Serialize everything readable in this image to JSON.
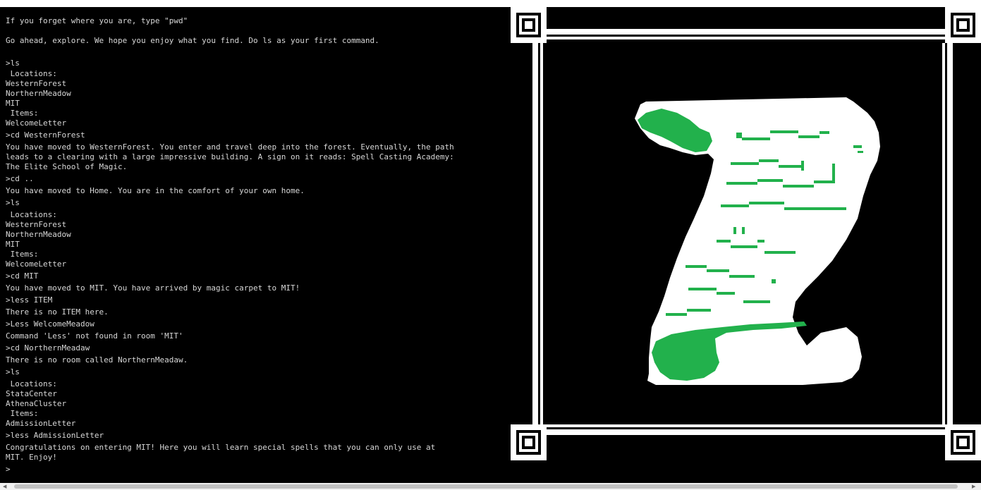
{
  "terminal": {
    "lines": [
      "If you forget where you are, type \"pwd\"",
      "Go ahead, explore. We hope you enjoy what you find. Do ls as your first command.",
      ">ls",
      " Locations:",
      "WesternForest",
      "NorthernMeadow",
      "MIT",
      " Items:",
      "WelcomeLetter",
      ">cd WesternForest",
      "You have moved to WesternForest. You enter and travel deep into the forest. Eventually, the path",
      "leads to a clearing with a large impressive building. A sign on it reads: Spell Casting Academy:",
      "The Elite School of Magic.",
      ">cd ..",
      "You have moved to Home. You are in the comfort of your own home.",
      ">ls",
      " Locations:",
      "WesternForest",
      "NorthernMeadow",
      "MIT",
      " Items:",
      "WelcomeLetter",
      ">cd MIT",
      "You have moved to MIT. You have arrived by magic carpet to MIT!",
      ">less ITEM",
      "There is no ITEM here.",
      ">Less WelcomeMeadow",
      "Command 'Less' not found in room 'MIT'",
      ">cd NorthernMeadaw",
      "There is no room called NorthernMeadaw.",
      ">ls",
      " Locations:",
      "StataCenter",
      "AthenaCluster",
      " Items:",
      "AdmissionLetter",
      ">less AdmissionLetter",
      "Congratulations on entering MIT! Here you will learn special spells that you can only use at",
      "MIT. Enjoy!",
      ">"
    ]
  },
  "art": {
    "icon": "scroll-icon",
    "colors": {
      "ink": "#22b14c",
      "paper": "#ffffff",
      "background": "#000000"
    }
  },
  "scrollbar": {
    "position_fraction": 0.0
  }
}
